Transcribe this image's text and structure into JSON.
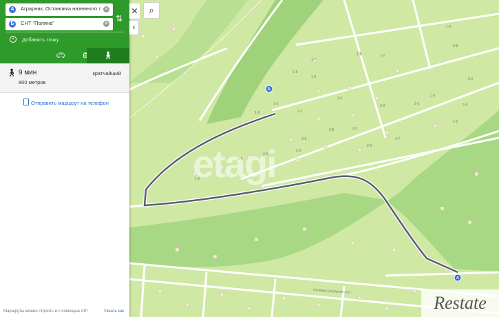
{
  "route": {
    "from": "Аграрник, Остановка наземного т",
    "to": "СНТ \"Поляна\"",
    "from_marker": "A",
    "to_marker": "Б",
    "add_point": "Добавить точку",
    "modes": [
      "car",
      "bus",
      "walk"
    ],
    "active_mode": "walk"
  },
  "result": {
    "time": "9 мин",
    "distance": "800 метров",
    "tag": "кратчайший"
  },
  "send_link": "Отправить маршрут на телефон",
  "footer": {
    "api_text": "Маршруты можно строить и с помощью API",
    "link": "Узнать как"
  },
  "map": {
    "street_label": "Нулевая (Аграрник снт)",
    "marker_a": "A",
    "marker_b": "Б",
    "plot_labels": [
      "1-9",
      "3-8",
      "1-6",
      "1-7",
      "1-2",
      "1-8",
      "1-5",
      "2-6",
      "3-2",
      "2-8",
      "1-9",
      "1-1",
      "2-2",
      "2-3",
      "2-5",
      "3-5",
      "3-8",
      "2-3",
      "2-7",
      "2-5",
      "1-5",
      "2-6",
      "2-6",
      "1-6",
      "3-6",
      "2-3"
    ]
  },
  "watermark": "etagi",
  "brand_watermark": "Restate",
  "colors": {
    "panel_green": "#2e9a2a",
    "map_light": "#cfe8a4",
    "map_dark": "#9fd27a",
    "route_line": "#5a5f6e"
  }
}
